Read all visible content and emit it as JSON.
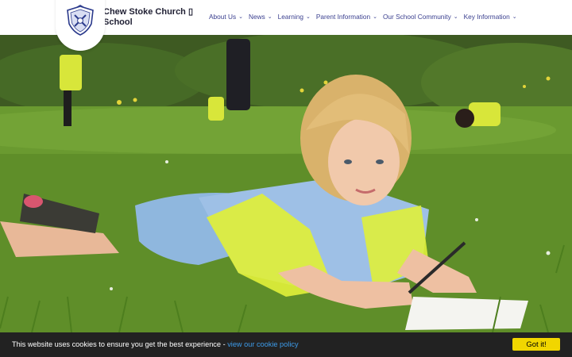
{
  "site": {
    "name": "Chew Stoke Church ▯ School",
    "logo_icon": "school-crest-icon"
  },
  "nav": [
    {
      "label": "About Us",
      "icon": "chevron-down-icon"
    },
    {
      "label": "News",
      "icon": "chevron-down-icon"
    },
    {
      "label": "Learning",
      "icon": "chevron-down-icon"
    },
    {
      "label": "Parent Information",
      "icon": "chevron-down-icon"
    },
    {
      "label": "Our School Community",
      "icon": "chevron-down-icon"
    },
    {
      "label": "Key Information",
      "icon": "chevron-down-icon"
    }
  ],
  "cookie": {
    "message": "This website uses cookies to ensure you get the best experience - ",
    "link_label": "view our cookie policy",
    "button_label": "Got it!"
  },
  "colors": {
    "nav_text": "#3a3f8f",
    "cookie_bg": "#222222",
    "cookie_link": "#3d9be9",
    "cookie_button": "#f1d600"
  }
}
